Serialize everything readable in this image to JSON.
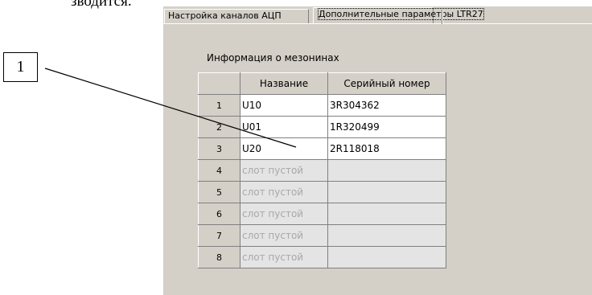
{
  "document": {
    "fragment_text": "зводится.",
    "callout_label": "1"
  },
  "tabs": [
    {
      "label": "Настройка каналов АЦП",
      "active": false
    },
    {
      "label": "Дополнительные параметры LTR27",
      "active": true
    }
  ],
  "group": {
    "caption": "Информация о мезонинах",
    "columns": [
      "",
      "Название",
      "Серийный номер"
    ],
    "rows": [
      {
        "index": "1",
        "name": "U10",
        "serial": "3R304362"
      },
      {
        "index": "2",
        "name": "U01",
        "serial": "1R320499"
      },
      {
        "index": "3",
        "name": "U20",
        "serial": "2R118018"
      },
      {
        "index": "4",
        "name": "слот пустой",
        "serial": ""
      },
      {
        "index": "5",
        "name": "слот пустой",
        "serial": ""
      },
      {
        "index": "6",
        "name": "слот пустой",
        "serial": ""
      },
      {
        "index": "7",
        "name": "слот пустой",
        "serial": ""
      },
      {
        "index": "8",
        "name": "слот пустой",
        "serial": ""
      }
    ]
  },
  "colors": {
    "dialog_face": "#d4d0c8",
    "empty_cell": "#e4e4e4",
    "empty_text": "#a8a8a8"
  }
}
